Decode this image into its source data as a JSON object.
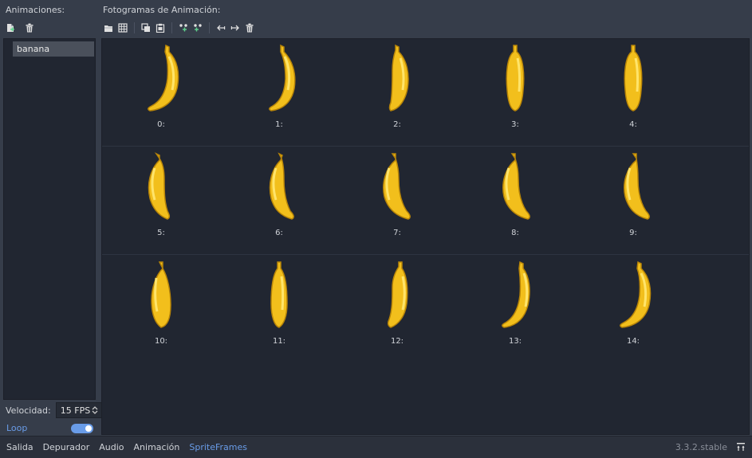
{
  "left_panel": {
    "title": "Animaciones:",
    "animations": [
      "banana"
    ],
    "speed_label": "Velocidad:",
    "speed_value": "15 FPS",
    "loop_label": "Loop",
    "loop_enabled": true
  },
  "right_panel": {
    "title": "Fotogramas de Animación:",
    "frames": [
      {
        "label": "0:",
        "selected": true
      },
      {
        "label": "1:"
      },
      {
        "label": "2:"
      },
      {
        "label": "3:"
      },
      {
        "label": "4:"
      },
      {
        "label": "5:"
      },
      {
        "label": "6:"
      },
      {
        "label": "7:"
      },
      {
        "label": "8:"
      },
      {
        "label": "9:"
      },
      {
        "label": "10:"
      },
      {
        "label": "11:"
      },
      {
        "label": "12:"
      },
      {
        "label": "13:"
      },
      {
        "label": "14:"
      }
    ]
  },
  "bottom_bar": {
    "tabs": [
      "Salida",
      "Depurador",
      "Audio",
      "Animación",
      "SpriteFrames"
    ],
    "active_tab": "SpriteFrames",
    "version": "3.3.2.stable"
  },
  "colors": {
    "accent": "#699ce8",
    "background": "#363d4a",
    "panel": "#212631",
    "banana": "#f5c518"
  }
}
